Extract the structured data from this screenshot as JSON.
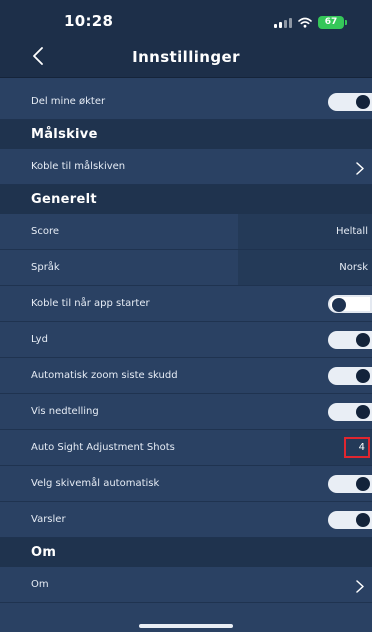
{
  "status_bar": {
    "time": "10:28",
    "battery": "67"
  },
  "nav": {
    "title": "Innstillinger"
  },
  "rows": {
    "share_sessions": {
      "label": "Del mine økter",
      "toggle": "on"
    },
    "target_section": "Målskive",
    "connect_target": {
      "label": "Koble til målskiven"
    },
    "general_section": "Generelt",
    "score": {
      "label": "Score",
      "value": "Heltall"
    },
    "language": {
      "label": "Språk",
      "value": "Norsk"
    },
    "connect_on_start": {
      "label": "Koble til når app starter",
      "toggle": "off"
    },
    "sound": {
      "label": "Lyd",
      "toggle": "on"
    },
    "auto_zoom": {
      "label": "Automatisk zoom siste skudd",
      "toggle": "on"
    },
    "countdown": {
      "label": "Vis nedtelling",
      "toggle": "on"
    },
    "auto_sight": {
      "label": "Auto Sight Adjustment Shots",
      "value": "4"
    },
    "auto_target": {
      "label": "Velg skivemål automatisk",
      "toggle": "on"
    },
    "notifications": {
      "label": "Varsler",
      "toggle": "on"
    },
    "about_section": "Om",
    "about": {
      "label": "Om"
    }
  },
  "colors": {
    "background": "#2a4163",
    "header": "#1d2f49",
    "section": "#1f334e",
    "highlight": "#e0262f",
    "battery": "#35c759"
  },
  "icons": [
    "back-chevron-icon",
    "signal-icon",
    "wifi-icon",
    "battery-icon",
    "chevron-right-icon"
  ]
}
